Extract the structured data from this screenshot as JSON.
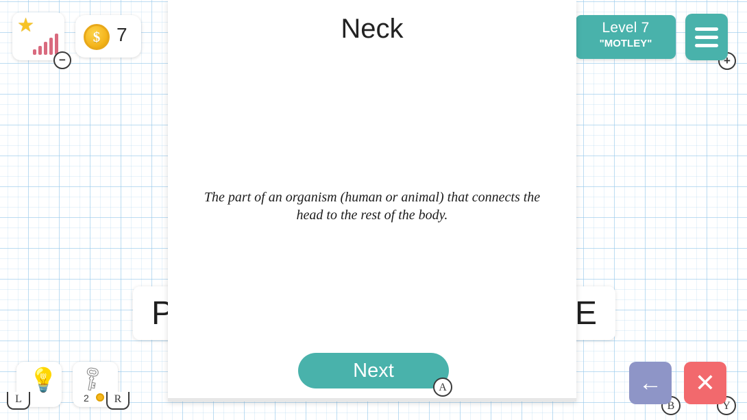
{
  "hud": {
    "star_icon": "star-icon",
    "signal_icon": "signal-bars-icon",
    "coin_icon_label": "$",
    "coin_count": "7",
    "minus_label": "−",
    "plus_label": "+"
  },
  "level": {
    "title": "Level 7",
    "word": "\"MOTLEY\""
  },
  "menu": {
    "label": "menu"
  },
  "tiles": {
    "left_letter": "P",
    "right_letter": "E"
  },
  "card": {
    "title": "Neck",
    "definition": "The part of an organism (human or animal) that connects the head to the rest of the body.",
    "next_label": "Next"
  },
  "controller": {
    "a_label": "A",
    "b_label": "B",
    "y_label": "Y",
    "l_label": "L",
    "r_label": "R"
  },
  "tools": {
    "hint_icon": "lightbulb-icon",
    "key_icon": "key-icon",
    "key_count": "2"
  },
  "nav": {
    "back_label": "←",
    "close_label": "✕"
  },
  "colors": {
    "accent_teal": "#49b2ab",
    "coin_gold": "#f5b61e",
    "back_purple": "#8e95c7",
    "close_red": "#f2696d",
    "grid_blue": "#96c8eb"
  }
}
